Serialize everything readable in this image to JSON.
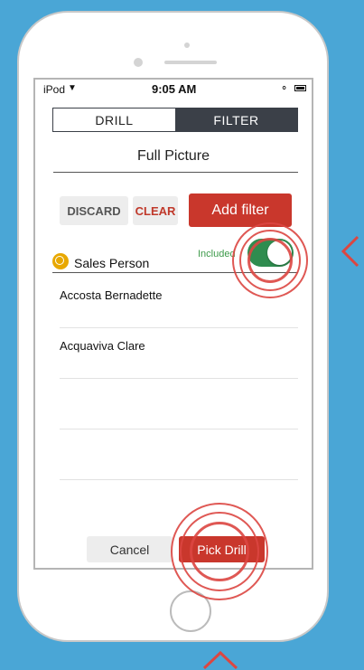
{
  "status_bar": {
    "carrier": "iPod",
    "wifi_icon": "wifi-icon",
    "time": "9:05 AM",
    "lock_icon": "orientation-lock-icon",
    "battery_icon": "battery-icon"
  },
  "segmented": {
    "drill_label": "DRILL",
    "filter_label": "FILTER",
    "selected": "FILTER"
  },
  "page": {
    "title": "Full Picture"
  },
  "filter_actions": {
    "discard_label": "DISCARD",
    "clear_label": "CLEAR",
    "add_filter_label": "Add filter"
  },
  "dimension": {
    "icon": "dimension-circle-icon",
    "label": "Sales Person",
    "included_label": "Included",
    "included": true
  },
  "values": [
    {
      "label": "Accosta Bernadette"
    },
    {
      "label": "Acquaviva Clare"
    },
    {
      "label": ""
    },
    {
      "label": ""
    }
  ],
  "footer": {
    "cancel_label": "Cancel",
    "pick_drill_label": "Pick Drill"
  },
  "colors": {
    "background": "#4aa6d6",
    "accent_red": "#c9372c",
    "toggle_green": "#2f8c4f",
    "segment_dark": "#3b4048",
    "hint_red": "#dc4641"
  },
  "hints": {
    "side_arrow": "chevron-left-icon",
    "bottom_arrow": "chevron-up-icon"
  }
}
